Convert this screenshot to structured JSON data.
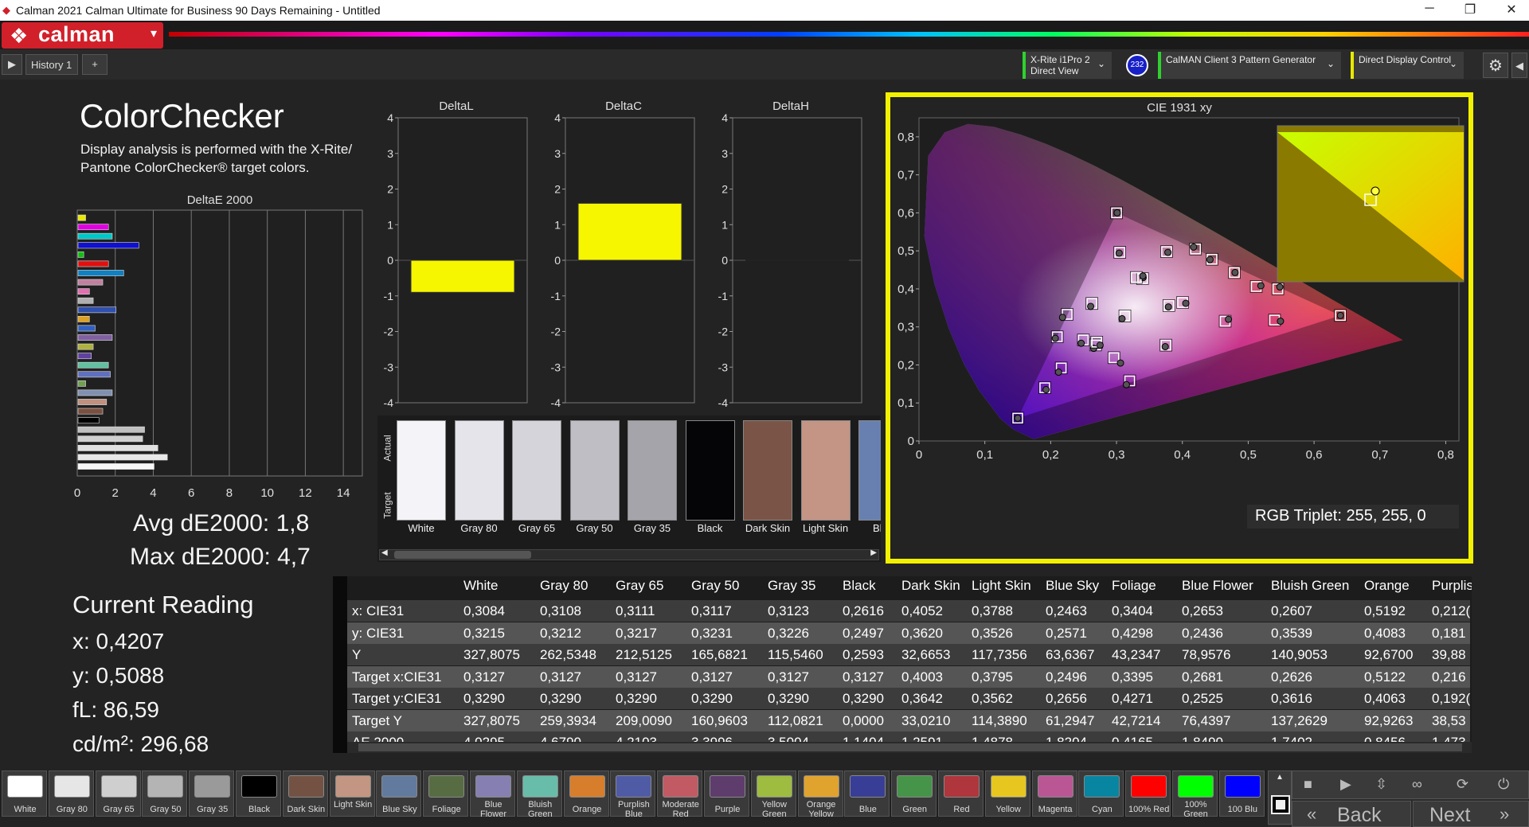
{
  "window": {
    "title": "Calman 2021 Calman Ultimate for Business 90 Days Remaining  - Untitled",
    "minimize": "─",
    "restore": "❐",
    "close": "✕"
  },
  "brand": {
    "name": "calman",
    "mark": "❖",
    "dropdown": "▾"
  },
  "toolbar": {
    "history_tab": "History 1",
    "add_tab": "+",
    "meter": {
      "line1": "X-Rite i1Pro 2",
      "line2": "Direct View",
      "badge": "232"
    },
    "generator": {
      "label": "CalMAN Client 3 Pattern Generator"
    },
    "display": {
      "label": "Direct Display Control"
    },
    "settings_icon": "⚙",
    "collapse_icon": "◀"
  },
  "colorchecker": {
    "title": "ColorChecker",
    "description": "Display analysis is performed with the X-Rite/ Pantone ColorChecker® target colors."
  },
  "deltae_panel": {
    "title": "DeltaE 2000",
    "ticks": [
      "0",
      "2",
      "4",
      "6",
      "8",
      "10",
      "12",
      "14"
    ],
    "avg_label": "Avg dE2000: 1,8",
    "max_label": "Max dE2000: 4,7",
    "bars": [
      {
        "color": "#e8e800",
        "value": 0.4
      },
      {
        "color": "#e000e0",
        "value": 1.6
      },
      {
        "color": "#00c8c8",
        "value": 1.8
      },
      {
        "color": "#1010d0",
        "value": 3.2
      },
      {
        "color": "#10c010",
        "value": 0.3
      },
      {
        "color": "#e01010",
        "value": 1.6
      },
      {
        "color": "#1080c0",
        "value": 2.4
      },
      {
        "color": "#c080a0",
        "value": 1.3
      },
      {
        "color": "#e070b0",
        "value": 0.6
      },
      {
        "color": "#b0b0b0",
        "value": 0.8
      },
      {
        "color": "#3050b0",
        "value": 2.0
      },
      {
        "color": "#e0a020",
        "value": 0.6
      },
      {
        "color": "#3060c0",
        "value": 0.9
      },
      {
        "color": "#8060a0",
        "value": 1.8
      },
      {
        "color": "#b0b040",
        "value": 0.8
      },
      {
        "color": "#6040a0",
        "value": 0.7
      },
      {
        "color": "#60c0a0",
        "value": 1.6
      },
      {
        "color": "#6070c0",
        "value": 1.7
      },
      {
        "color": "#70a050",
        "value": 0.4
      },
      {
        "color": "#8090b0",
        "value": 1.8
      },
      {
        "color": "#c09080",
        "value": 1.5
      },
      {
        "color": "#7a5040",
        "value": 1.3
      },
      {
        "color": "#000000",
        "value": 1.1
      },
      {
        "color": "#c0c0c0",
        "value": 3.5
      },
      {
        "color": "#d0d0d0",
        "value": 3.4
      },
      {
        "color": "#e0e0e0",
        "value": 4.2
      },
      {
        "color": "#e8e8e8",
        "value": 4.7
      },
      {
        "color": "#f8f8f8",
        "value": 4.0
      }
    ]
  },
  "current_reading": {
    "title": "Current Reading",
    "x": "x: 0,4207",
    "y": "y: 0,5088",
    "fl": "fL: 86,59",
    "cdm2": "cd/m²: 296,68"
  },
  "delta_charts": [
    {
      "title": "DeltaL",
      "value": -0.9
    },
    {
      "title": "DeltaC",
      "value": 1.6
    },
    {
      "title": "DeltaH",
      "value": 0.0
    }
  ],
  "delta_ticks": [
    "4",
    "3",
    "2",
    "1",
    "0",
    "-1",
    "-2",
    "-3",
    "-4"
  ],
  "swatch_strip": {
    "actual_label": "Actual",
    "target_label": "Target",
    "items": [
      {
        "label": "White",
        "color": "#f4f4f8"
      },
      {
        "label": "Gray 80",
        "color": "#e4e4ea"
      },
      {
        "label": "Gray 65",
        "color": "#d4d4da"
      },
      {
        "label": "Gray 50",
        "color": "#bebec4"
      },
      {
        "label": "Gray 35",
        "color": "#a4a4aa"
      },
      {
        "label": "Black",
        "color": "#050508"
      },
      {
        "label": "Dark Skin",
        "color": "#7a5446"
      },
      {
        "label": "Light Skin",
        "color": "#c49484"
      },
      {
        "label": "Blue",
        "color": "#6880b0"
      }
    ]
  },
  "cie": {
    "title": "CIE 1931 xy",
    "xticks": [
      "0",
      "0,1",
      "0,2",
      "0,3",
      "0,4",
      "0,5",
      "0,6",
      "0,7",
      "0,8"
    ],
    "yticks": [
      "0,8",
      "0,7",
      "0,6",
      "0,5",
      "0,4",
      "0,3",
      "0,2",
      "0,1",
      "0"
    ],
    "rgb_triplet": "RGB Triplet: 255, 255, 0",
    "points": [
      {
        "x": 0.301,
        "y": 0.6,
        "tx": 0.3,
        "ty": 0.6
      },
      {
        "x": 0.64,
        "y": 0.33,
        "tx": 0.64,
        "ty": 0.33
      },
      {
        "x": 0.15,
        "y": 0.06,
        "tx": 0.15,
        "ty": 0.06
      },
      {
        "x": 0.3084,
        "y": 0.3215,
        "tx": 0.3127,
        "ty": 0.329
      },
      {
        "x": 0.4052,
        "y": 0.362,
        "tx": 0.4003,
        "ty": 0.3642
      },
      {
        "x": 0.3788,
        "y": 0.3526,
        "tx": 0.3795,
        "ty": 0.3562
      },
      {
        "x": 0.2463,
        "y": 0.2571,
        "tx": 0.2496,
        "ty": 0.2656
      },
      {
        "x": 0.3404,
        "y": 0.4298,
        "tx": 0.3395,
        "ty": 0.4271
      },
      {
        "x": 0.2653,
        "y": 0.2436,
        "tx": 0.2681,
        "ty": 0.2525
      },
      {
        "x": 0.2607,
        "y": 0.3539,
        "tx": 0.2626,
        "ty": 0.3616
      },
      {
        "x": 0.5192,
        "y": 0.4083,
        "tx": 0.5122,
        "ty": 0.4063
      },
      {
        "x": 0.212,
        "y": 0.181,
        "tx": 0.216,
        "ty": 0.192
      },
      {
        "x": 0.47,
        "y": 0.32,
        "tx": 0.465,
        "ty": 0.315
      },
      {
        "x": 0.306,
        "y": 0.205,
        "tx": 0.296,
        "ty": 0.219
      },
      {
        "x": 0.378,
        "y": 0.496,
        "tx": 0.376,
        "ty": 0.498
      },
      {
        "x": 0.442,
        "y": 0.477,
        "tx": 0.445,
        "ty": 0.478
      },
      {
        "x": 0.193,
        "y": 0.135,
        "tx": 0.191,
        "ty": 0.14
      },
      {
        "x": 0.304,
        "y": 0.494,
        "tx": 0.305,
        "ty": 0.496
      },
      {
        "x": 0.549,
        "y": 0.315,
        "tx": 0.54,
        "ty": 0.318
      },
      {
        "x": 0.417,
        "y": 0.51,
        "tx": 0.42,
        "ty": 0.505
      },
      {
        "x": 0.374,
        "y": 0.248,
        "tx": 0.375,
        "ty": 0.252
      },
      {
        "x": 0.207,
        "y": 0.27,
        "tx": 0.21,
        "ty": 0.274
      },
      {
        "x": 0.218,
        "y": 0.325,
        "tx": 0.225,
        "ty": 0.333
      },
      {
        "x": 0.315,
        "y": 0.148,
        "tx": 0.32,
        "ty": 0.158
      },
      {
        "x": 0.548,
        "y": 0.405,
        "tx": 0.545,
        "ty": 0.4
      },
      {
        "x": 0.48,
        "y": 0.443,
        "tx": 0.479,
        "ty": 0.443
      },
      {
        "x": 0.275,
        "y": 0.252,
        "tx": 0.27,
        "ty": 0.26
      },
      {
        "x": 0.34,
        "y": 0.434,
        "tx": 0.33,
        "ty": 0.43
      }
    ],
    "inset_point": {
      "x": 0.4207,
      "y": 0.5088
    }
  },
  "table": {
    "columns": [
      "",
      "White",
      "Gray 80",
      "Gray 65",
      "Gray 50",
      "Gray 35",
      "Black",
      "Dark Skin",
      "Light Skin",
      "Blue Sky",
      "Foliage",
      "Blue Flower",
      "Bluish Green",
      "Orange",
      "Purplis"
    ],
    "rows": [
      [
        "x: CIE31",
        "0,3084",
        "0,3108",
        "0,3111",
        "0,3117",
        "0,3123",
        "0,2616",
        "0,4052",
        "0,3788",
        "0,2463",
        "0,3404",
        "0,2653",
        "0,2607",
        "0,5192",
        "0,212("
      ],
      [
        "y: CIE31",
        "0,3215",
        "0,3212",
        "0,3217",
        "0,3231",
        "0,3226",
        "0,2497",
        "0,3620",
        "0,3526",
        "0,2571",
        "0,4298",
        "0,2436",
        "0,3539",
        "0,4083",
        "0,181"
      ],
      [
        "Y",
        "327,8075",
        "262,5348",
        "212,5125",
        "165,6821",
        "115,5460",
        "0,2593",
        "32,6653",
        "117,7356",
        "63,6367",
        "43,2347",
        "78,9576",
        "140,9053",
        "92,6700",
        "39,88"
      ],
      [
        "Target x:CIE31",
        "0,3127",
        "0,3127",
        "0,3127",
        "0,3127",
        "0,3127",
        "0,3127",
        "0,4003",
        "0,3795",
        "0,2496",
        "0,3395",
        "0,2681",
        "0,2626",
        "0,5122",
        "0,216"
      ],
      [
        "Target y:CIE31",
        "0,3290",
        "0,3290",
        "0,3290",
        "0,3290",
        "0,3290",
        "0,3290",
        "0,3642",
        "0,3562",
        "0,2656",
        "0,4271",
        "0,2525",
        "0,3616",
        "0,4063",
        "0,192("
      ],
      [
        "Target Y",
        "327,8075",
        "259,3934",
        "209,0090",
        "160,9603",
        "112,0821",
        "0,0000",
        "33,0210",
        "114,3890",
        "61,2947",
        "42,7214",
        "76,4397",
        "137,2629",
        "92,9263",
        "38,53"
      ],
      [
        "ΔE 2000",
        "4,0295",
        "4,6790",
        "4,2103",
        "3,3996",
        "3,5004",
        "1,1404",
        "1,2591",
        "1,4878",
        "1,8204",
        "0,4165",
        "1,8490",
        "1,7402",
        "0,8456",
        "1,473"
      ]
    ]
  },
  "palette": [
    {
      "label": "White",
      "color": "#ffffff"
    },
    {
      "label": "Gray 80",
      "color": "#e6e6e6"
    },
    {
      "label": "Gray 65",
      "color": "#cfcfcf"
    },
    {
      "label": "Gray 50",
      "color": "#b4b4b4"
    },
    {
      "label": "Gray 35",
      "color": "#9a9a9a"
    },
    {
      "label": "Black",
      "color": "#000000"
    },
    {
      "label": "Dark Skin",
      "color": "#735244"
    },
    {
      "label": "Light Skin",
      "color": "#c29682"
    },
    {
      "label": "Blue Sky",
      "color": "#627a9d"
    },
    {
      "label": "Foliage",
      "color": "#576c43"
    },
    {
      "label": "Blue Flower",
      "color": "#8580b1"
    },
    {
      "label": "Bluish Green",
      "color": "#67bdaa"
    },
    {
      "label": "Orange",
      "color": "#d67e2c"
    },
    {
      "label": "Purplish Blue",
      "color": "#505ba6"
    },
    {
      "label": "Moderate Red",
      "color": "#c15a63"
    },
    {
      "label": "Purple",
      "color": "#5e3c6c"
    },
    {
      "label": "Yellow Green",
      "color": "#9dbc40"
    },
    {
      "label": "Orange Yellow",
      "color": "#e0a32e"
    },
    {
      "label": "Blue",
      "color": "#383d96"
    },
    {
      "label": "Green",
      "color": "#469449"
    },
    {
      "label": "Red",
      "color": "#af363c"
    },
    {
      "label": "Yellow",
      "color": "#e7c71f"
    },
    {
      "label": "Magenta",
      "color": "#bb5695"
    },
    {
      "label": "Cyan",
      "color": "#0885a1"
    },
    {
      "label": "100% Red",
      "color": "#ff0000"
    },
    {
      "label": "100% Green",
      "color": "#00ff00"
    },
    {
      "label": "100 Blu",
      "color": "#0000ff"
    }
  ],
  "nav": {
    "back": "Back",
    "next": "Next",
    "back_icon": "«",
    "next_icon": "»"
  }
}
